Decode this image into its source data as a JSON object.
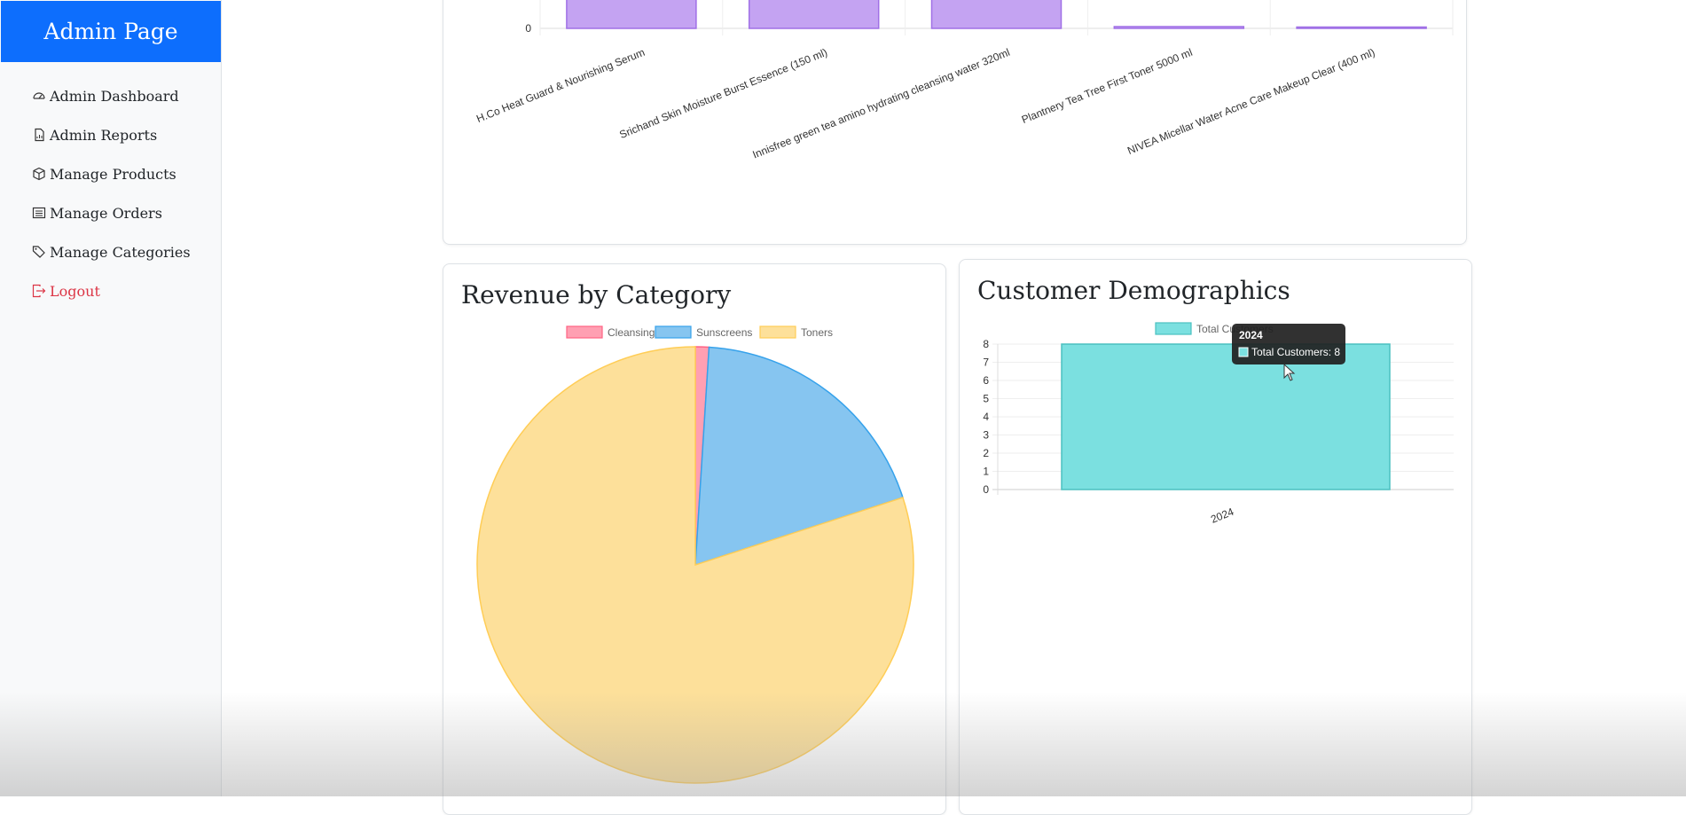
{
  "sidebar": {
    "brand": "Admin Page",
    "items": [
      {
        "label": "Admin Dashboard",
        "icon": "speedometer-icon"
      },
      {
        "label": "Admin Reports",
        "icon": "report-file-icon"
      },
      {
        "label": "Manage Products",
        "icon": "box-icon"
      },
      {
        "label": "Manage Orders",
        "icon": "list-icon"
      },
      {
        "label": "Manage Categories",
        "icon": "tags-icon"
      },
      {
        "label": "Logout",
        "icon": "logout-icon"
      }
    ]
  },
  "top_chart": {
    "chart_data": {
      "type": "bar",
      "categories": [
        "H.Co Heat Guard & Nourishing Serum",
        "Srichand Skin Moisture Burst Essence (150 ml)",
        "Innisfree green tea amino hydrating cleansing water 320ml",
        "Plantnery Tea Tree First Toner 5000 ml",
        "NIVEA Micellar Water Acne Care Makeup Clear (400 ml)"
      ],
      "values": [
        10,
        10,
        10,
        0.4,
        0.3
      ],
      "y_tick_visible": "0",
      "color": "#c4a3f2"
    }
  },
  "revenue_card": {
    "title": "Revenue by Category",
    "chart_data": {
      "type": "pie",
      "labels": [
        "Cleansing",
        "Sunscreens",
        "Toners"
      ],
      "values": [
        1,
        19,
        80
      ],
      "colors": [
        "#ff9fb2",
        "#86c5f0",
        "#fde09a"
      ],
      "border_colors": [
        "#ff6384",
        "#36a2eb",
        "#ffcd56"
      ],
      "legend": "top"
    }
  },
  "demographics_card": {
    "title": "Customer Demographics",
    "chart_data": {
      "type": "bar",
      "categories": [
        "2024"
      ],
      "series": [
        {
          "name": "Total Customers",
          "values": [
            8
          ]
        }
      ],
      "ylim": [
        0,
        8
      ],
      "y_ticks": [
        "0",
        "1",
        "2",
        "3",
        "4",
        "5",
        "6",
        "7",
        "8"
      ],
      "color": "#7be0e0",
      "legend": "top"
    },
    "tooltip": {
      "title": "2024",
      "line": "Total Customers: 8"
    }
  }
}
